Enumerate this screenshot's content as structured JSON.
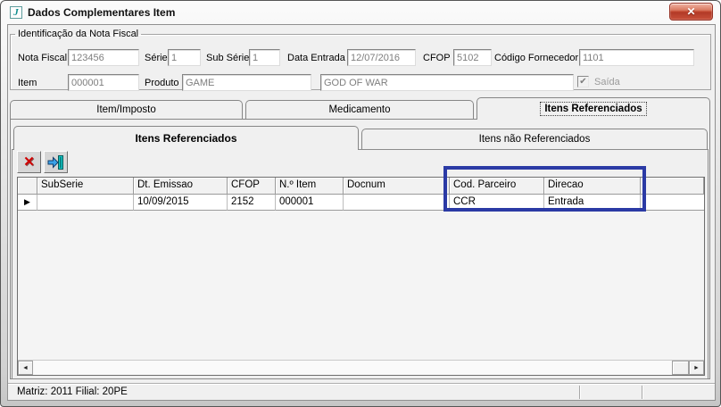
{
  "window": {
    "title": "Dados Complementares Item",
    "icon_glyph": "J",
    "close_glyph": "✕"
  },
  "identificacao": {
    "legend": "Identificação da Nota Fiscal",
    "nota_fiscal_label": "Nota Fiscal",
    "nota_fiscal_value": "123456",
    "serie_label": "Série",
    "serie_value": "1",
    "sub_serie_label": "Sub Série",
    "sub_serie_value": "1",
    "data_entrada_label": "Data Entrada",
    "data_entrada_value": "12/07/2016",
    "cfop_label": "CFOP",
    "cfop_value": "5102",
    "codigo_fornecedor_label": "Código Fornecedor",
    "codigo_fornecedor_value": "1101",
    "item_label": "Item",
    "item_value": "000001",
    "produto_label": "Produto",
    "produto_value": "GAME",
    "produto_descricao_value": "GOD OF WAR",
    "saida_label": "Saída",
    "saida_check_glyph": "✔"
  },
  "tabs": {
    "item_imposto": "Item/Imposto",
    "medicamento": "Medicamento",
    "itens_referenciados": "Itens Referenciados"
  },
  "subtabs": {
    "itens_referenciados": "Itens Referenciados",
    "itens_nao_referenciados": "Itens não Referenciados"
  },
  "toolbar": {
    "delete_glyph": "✕"
  },
  "grid": {
    "row_marker": "▶",
    "columns": [
      "SubSerie",
      "Dt. Emissao",
      "CFOP",
      "N.º Item",
      "Docnum",
      "Cod. Parceiro",
      "Direcao"
    ],
    "rows": [
      {
        "subserie": "",
        "dt_emissao": "10/09/2015",
        "cfop": "2152",
        "n_item": "000001",
        "docnum": "",
        "cod_parceiro": "CCR",
        "direcao": "Entrada"
      }
    ]
  },
  "scrollbar": {
    "left_glyph": "◄",
    "right_glyph": "►"
  },
  "statusbar": {
    "text": "Matriz: 2011 Filial: 20PE"
  },
  "annotation": {
    "color": "#2b3aa5"
  }
}
